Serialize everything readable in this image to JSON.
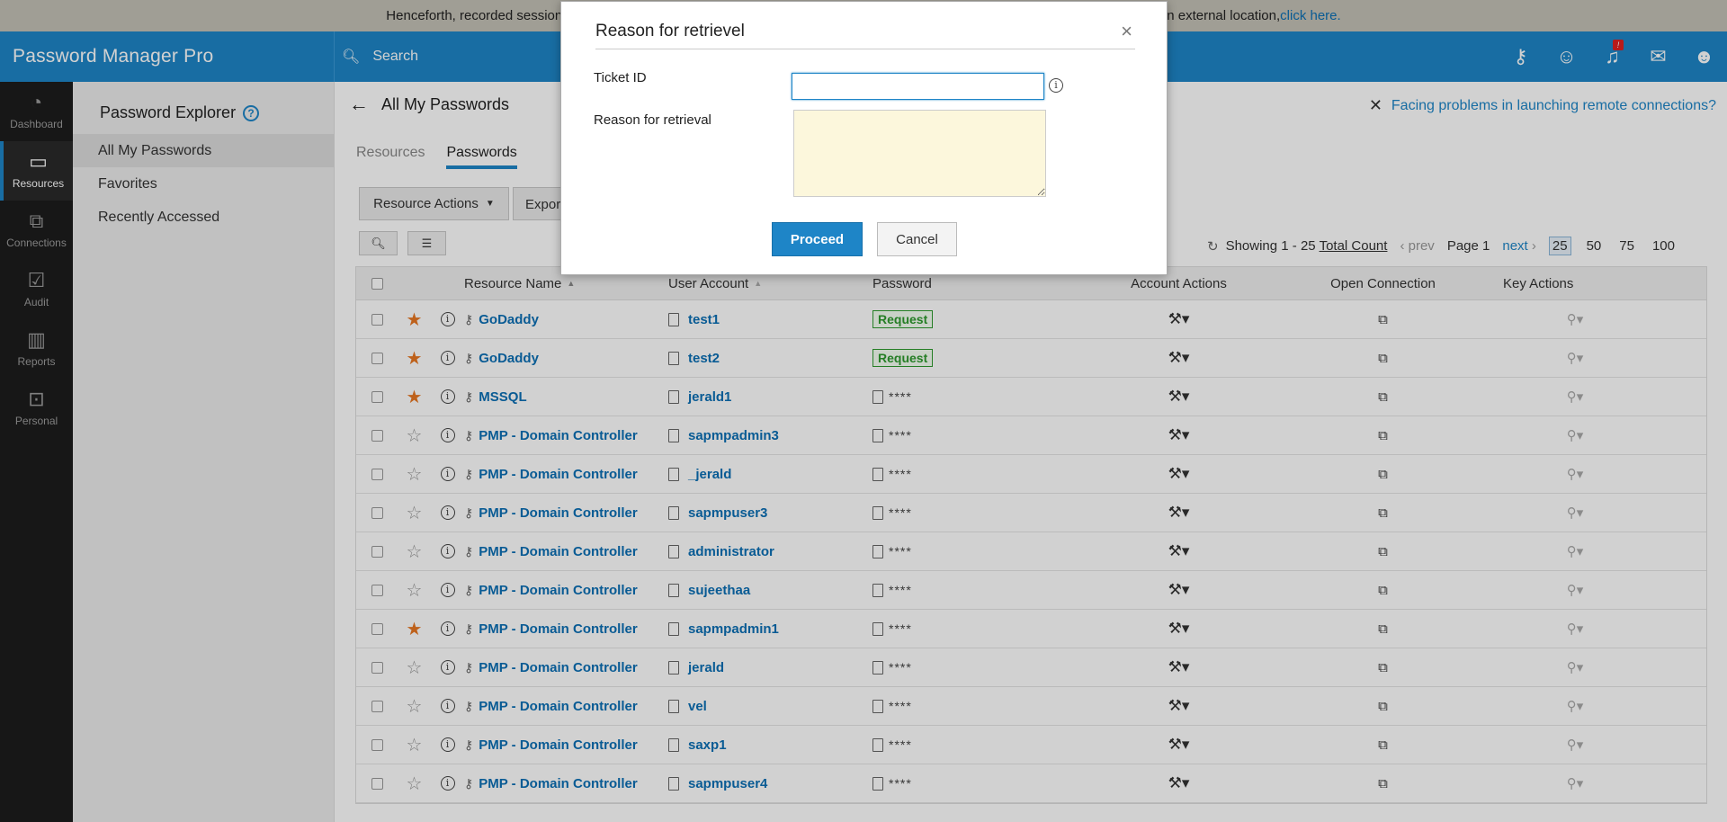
{
  "notice": {
    "text_left": "Henceforth, recorded session",
    "text_right": "n external location, ",
    "link": "click here."
  },
  "topbar": {
    "brand": "Password Manager Pro",
    "search_placeholder": "Search",
    "icons": [
      "connection-key-icon",
      "user-star-icon",
      "bell-icon",
      "mail-icon",
      "user-icon"
    ],
    "bell_badge": "!"
  },
  "sidebar": {
    "items": [
      {
        "label": "Dashboard",
        "icon": "dashboard-icon"
      },
      {
        "label": "Resources",
        "icon": "monitor-icon",
        "active": true
      },
      {
        "label": "Connections",
        "icon": "connections-icon"
      },
      {
        "label": "Audit",
        "icon": "clipboard-check-icon"
      },
      {
        "label": "Reports",
        "icon": "bar-chart-icon"
      },
      {
        "label": "Personal",
        "icon": "personal-icon"
      }
    ]
  },
  "explorer": {
    "title": "Password Explorer",
    "help": "?",
    "items": [
      "All My Passwords",
      "Favorites",
      "Recently Accessed"
    ]
  },
  "main": {
    "title": "All My Passwords",
    "help_link": "Facing problems in launching remote connections?",
    "tabs": [
      "Resources",
      "Passwords"
    ],
    "resource_actions": "Resource Actions",
    "export_partial": "Expor",
    "pager": {
      "showing": "Showing 1 - 25",
      "total": "Total Count",
      "prev": "prev",
      "page": "Page 1",
      "next": "next",
      "sizes": [
        "25",
        "50",
        "75",
        "100"
      ]
    }
  },
  "table": {
    "headers": {
      "resource": "Resource Name",
      "user": "User Account",
      "password": "Password",
      "account_actions": "Account Actions",
      "open_connection": "Open Connection",
      "key_actions": "Key Actions"
    },
    "rows": [
      {
        "fav": "★",
        "resource": "GoDaddy",
        "user": "test1",
        "password": "Request"
      },
      {
        "fav": "★",
        "resource": "GoDaddy",
        "user": "test2",
        "password": "Request"
      },
      {
        "fav": "★",
        "resource": "MSSQL",
        "user": "jerald1",
        "password": "****"
      },
      {
        "fav": "☆",
        "resource": "PMP - Domain Controller",
        "user": "sapmpadmin3",
        "password": "****"
      },
      {
        "fav": "☆",
        "resource": "PMP - Domain Controller",
        "user": "_jerald",
        "password": "****"
      },
      {
        "fav": "☆",
        "resource": "PMP - Domain Controller",
        "user": "sapmpuser3",
        "password": "****"
      },
      {
        "fav": "☆",
        "resource": "PMP - Domain Controller",
        "user": "administrator",
        "password": "****"
      },
      {
        "fav": "☆",
        "resource": "PMP - Domain Controller",
        "user": "sujeethaa",
        "password": "****"
      },
      {
        "fav": "★",
        "resource": "PMP - Domain Controller",
        "user": "sapmpadmin1",
        "password": "****"
      },
      {
        "fav": "☆",
        "resource": "PMP - Domain Controller",
        "user": "jerald",
        "password": "****"
      },
      {
        "fav": "☆",
        "resource": "PMP - Domain Controller",
        "user": "vel",
        "password": "****"
      },
      {
        "fav": "☆",
        "resource": "PMP - Domain Controller",
        "user": "saxp1",
        "password": "****"
      },
      {
        "fav": "☆",
        "resource": "PMP - Domain Controller",
        "user": "sapmpuser4",
        "password": "****"
      }
    ]
  },
  "modal": {
    "title": "Reason for retrievel",
    "close": "×",
    "ticket_label": "Ticket ID",
    "ticket_value": "",
    "reason_label": "Reason for retrieval",
    "proceed": "Proceed",
    "cancel": "Cancel"
  },
  "colors": {
    "accent": "#1e85c7",
    "favorite": "#e87722",
    "request": "#2e9a2e",
    "sidebar": "#1d1d1d"
  }
}
